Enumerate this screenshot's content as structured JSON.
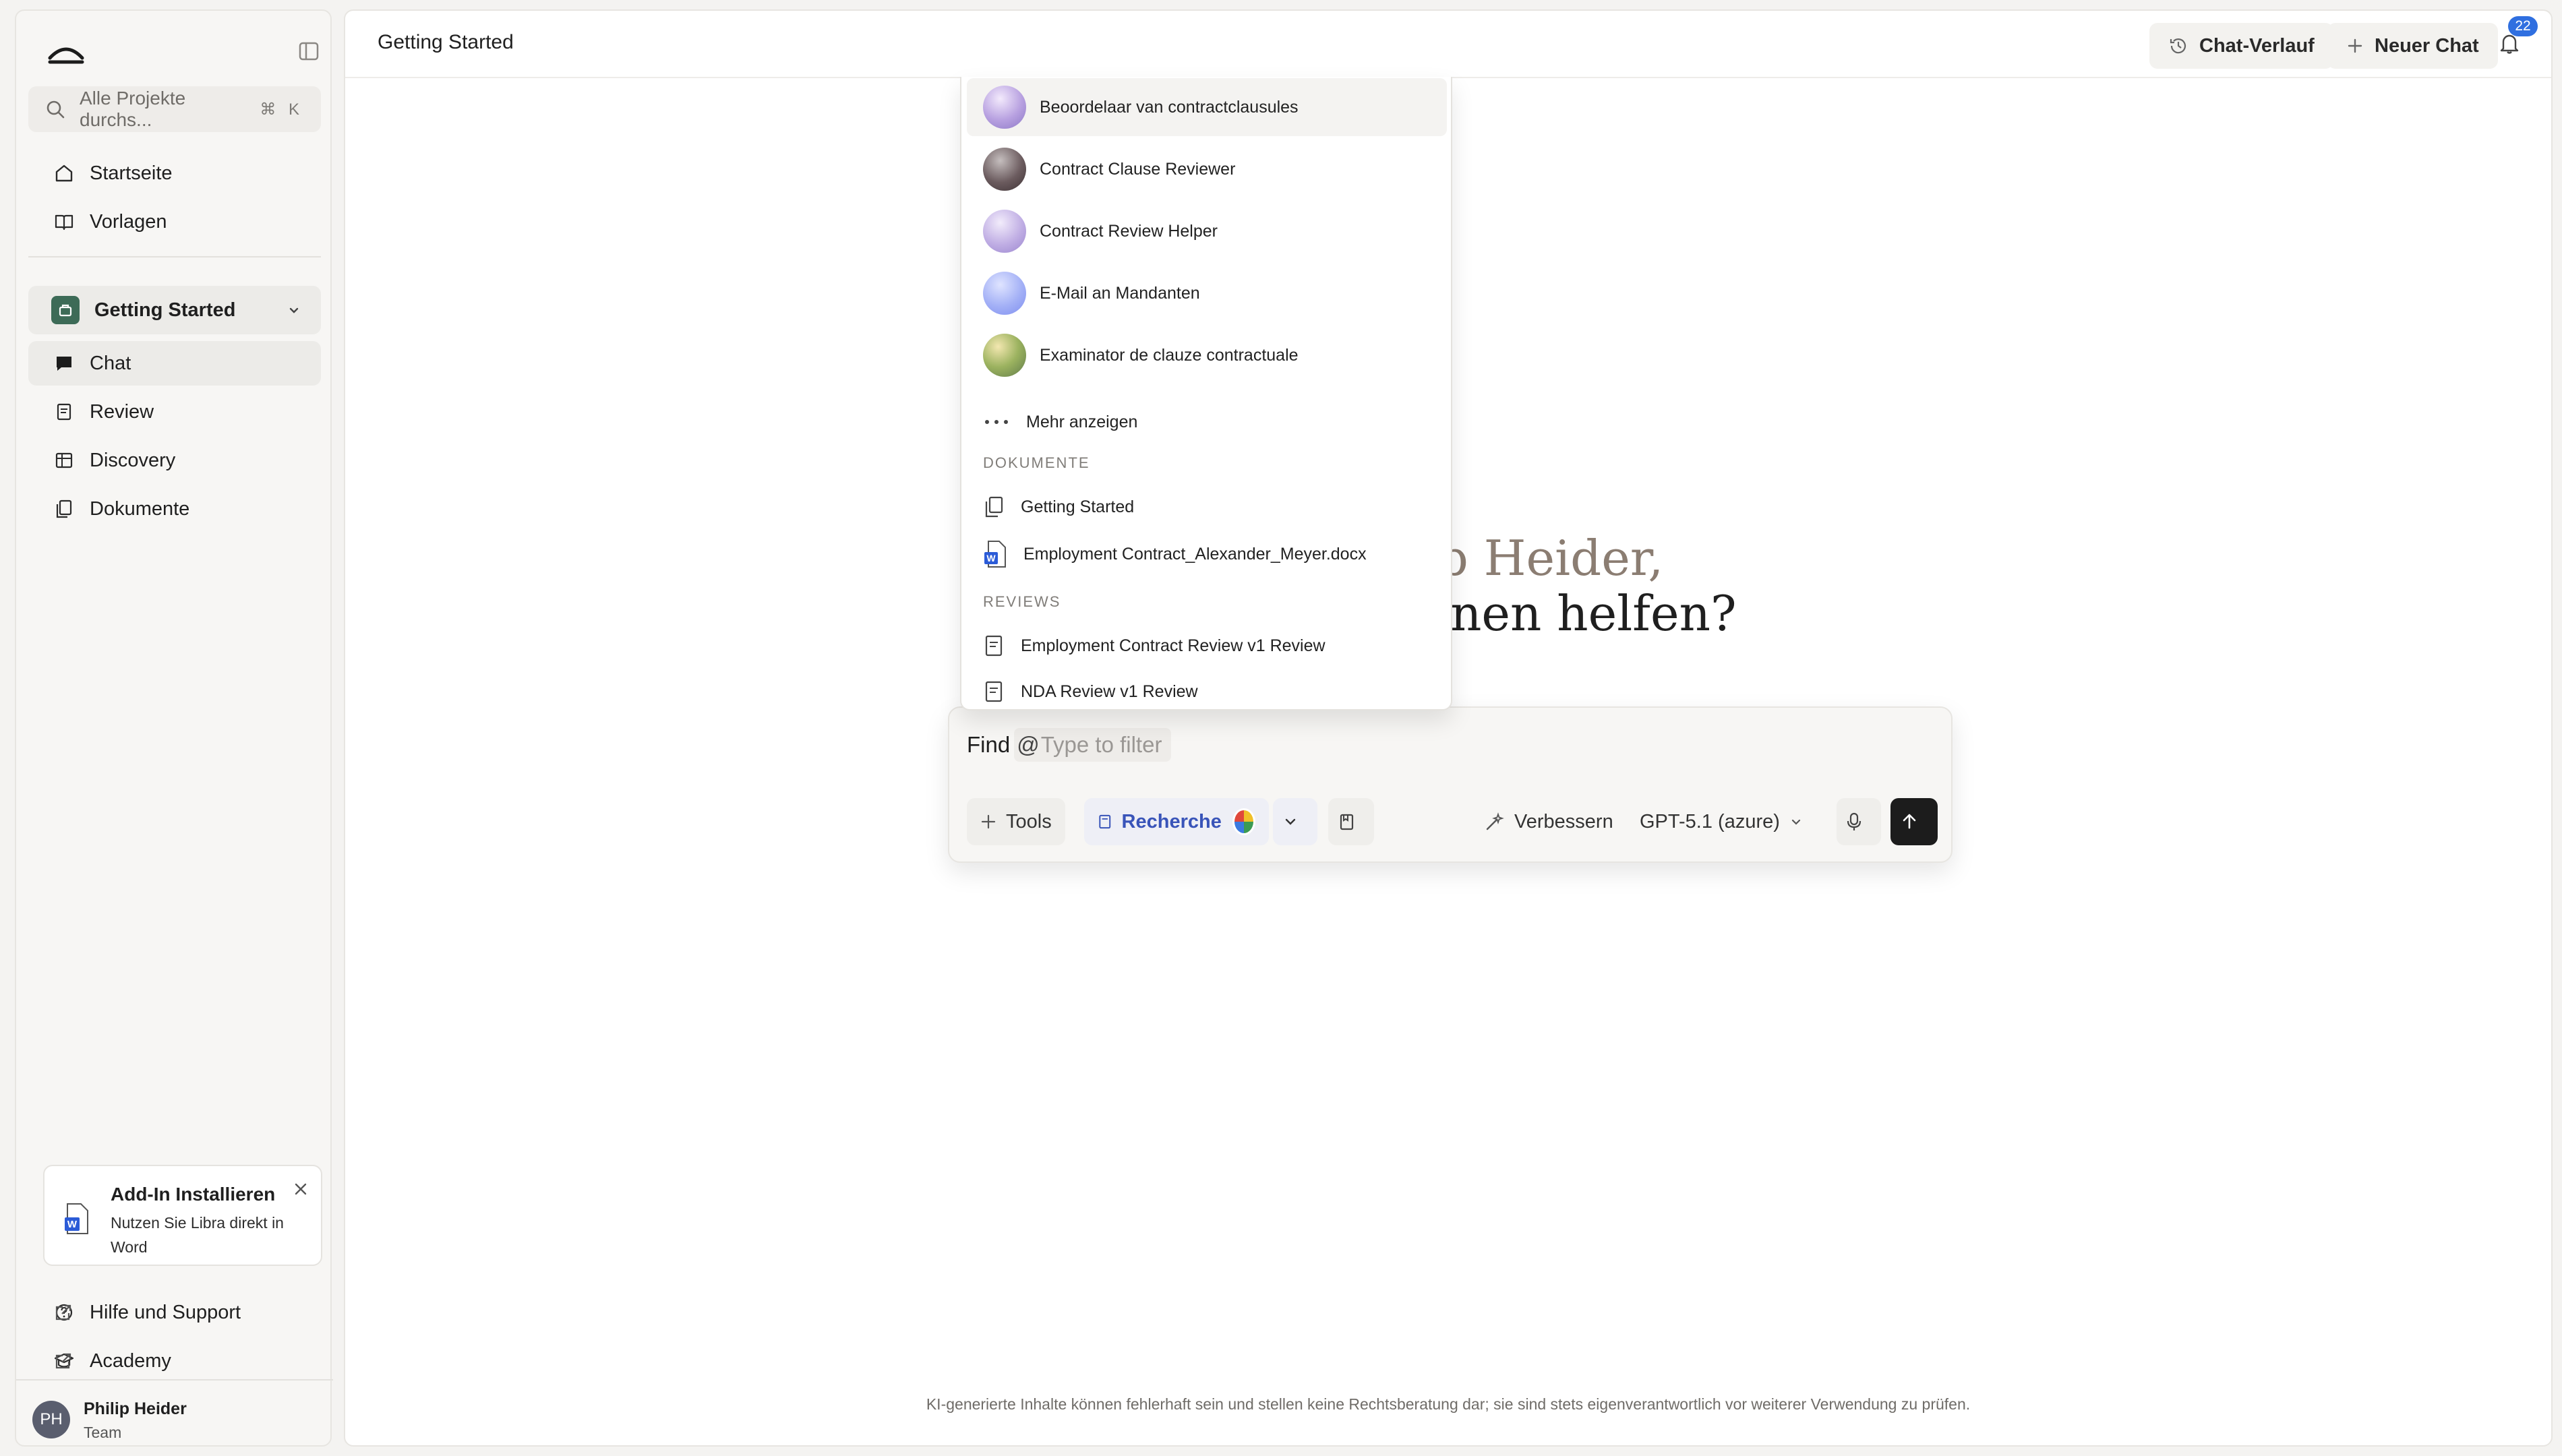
{
  "sidebar": {
    "search_placeholder": "Alle Projekte durchs...",
    "search_shortcut": "⌘ K",
    "nav": [
      {
        "label": "Startseite",
        "icon": "home-icon"
      },
      {
        "label": "Vorlagen",
        "icon": "book-icon"
      }
    ],
    "project": {
      "name": "Getting Started"
    },
    "project_nav": [
      {
        "label": "Chat",
        "icon": "chat-icon"
      },
      {
        "label": "Review",
        "icon": "review-icon"
      },
      {
        "label": "Discovery",
        "icon": "table-icon"
      },
      {
        "label": "Dokumente",
        "icon": "documents-icon"
      }
    ],
    "addin": {
      "title": "Add-In Installieren",
      "text": "Nutzen Sie Libra direkt in Word"
    },
    "help": "Hilfe und Support",
    "academy": "Academy",
    "user": {
      "initials": "PH",
      "name": "Philip Heider",
      "role": "Team"
    }
  },
  "header": {
    "title": "Getting Started",
    "history_label": "Chat-Verlauf",
    "new_chat_label": "Neuer Chat",
    "notification_count": "22"
  },
  "greeting": {
    "line1": "ip Heider,",
    "line2": "a Ihnen helfen?"
  },
  "dropdown": {
    "assistants": [
      {
        "label": "Beoordelaar van contractclausules",
        "orb": "lavender-orb"
      },
      {
        "label": "Contract Clause Reviewer",
        "orb": "dark-orb"
      },
      {
        "label": "Contract Review Helper",
        "orb": "lavender-orb"
      },
      {
        "label": "E-Mail an Mandanten",
        "orb": "blue-orb"
      },
      {
        "label": "Examinator de clauze contractuale",
        "orb": "green-orb"
      }
    ],
    "more_label": "Mehr anzeigen",
    "documents_header": "DOKUMENTE",
    "documents": [
      {
        "label": "Getting Started",
        "icon": "documents-icon"
      },
      {
        "label": "Employment Contract_Alexander_Meyer.docx",
        "icon": "word-file-icon"
      }
    ],
    "reviews_header": "REVIEWS",
    "reviews": [
      {
        "label": "Employment Contract Review v1 Review"
      },
      {
        "label": "NDA Review v1 Review"
      }
    ]
  },
  "composer": {
    "text": "Find",
    "at": "@",
    "filter_placeholder": "Type to filter",
    "tools_label": "Tools",
    "recherche_label": "Recherche",
    "improve_label": "Verbessern",
    "model_label": "GPT-5.1 (azure)"
  },
  "footer": "KI-generierte Inhalte können fehlerhaft sein und stellen keine Rechtsberatung dar; sie sind stets eigenverantwortlich vor weiterer Verwendung zu prüfen.",
  "colors": {
    "accent": "#3954b9",
    "project": "#3d6b57",
    "badge": "#2f6fe0",
    "send": "#1c1c1c"
  }
}
